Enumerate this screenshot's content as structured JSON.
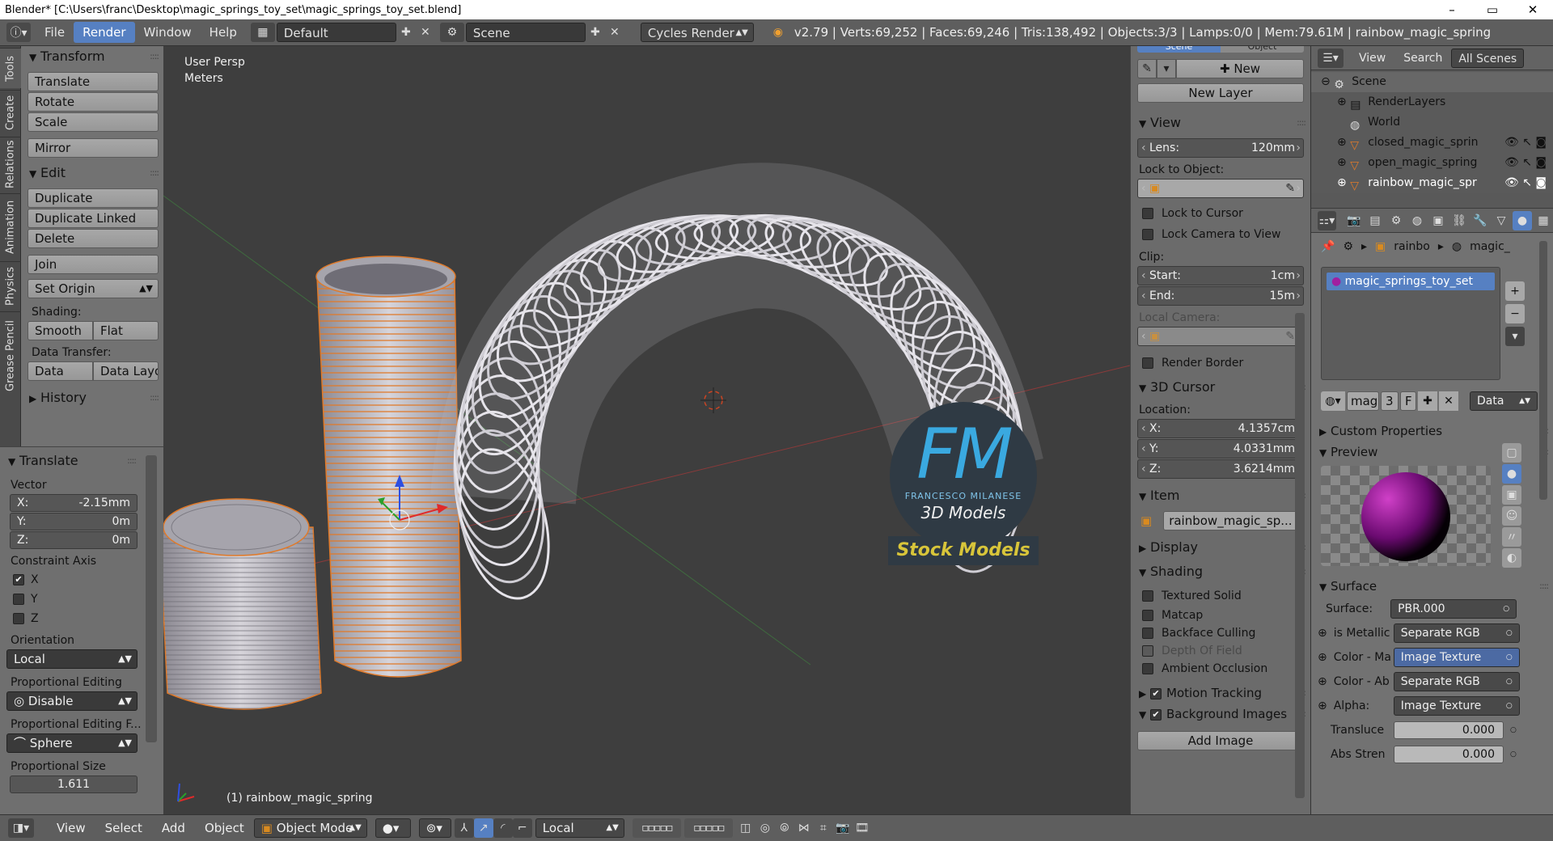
{
  "window": {
    "title": "Blender* [C:\\Users\\franc\\Desktop\\magic_springs_toy_set\\magic_springs_toy_set.blend]",
    "minimize": "–",
    "maximize": "▭",
    "close": "✕"
  },
  "menu": {
    "file": "File",
    "render": "Render",
    "window": "Window",
    "help": "Help",
    "layout": "Default",
    "scene": "Scene",
    "engine": "Cycles Render",
    "stats": "v2.79 | Verts:69,252 | Faces:69,246 | Tris:138,492 | Objects:3/3 | Lamps:0/0 | Mem:79.61M | rainbow_magic_spring"
  },
  "tool_tabs": [
    "Tools",
    "Create",
    "Relations",
    "Animation",
    "Physics",
    "Grease Pencil"
  ],
  "toolshelf": {
    "transform_header": "Transform",
    "translate": "Translate",
    "rotate": "Rotate",
    "scale": "Scale",
    "mirror": "Mirror",
    "edit_header": "Edit",
    "duplicate": "Duplicate",
    "duplicate_linked": "Duplicate Linked",
    "delete": "Delete",
    "join": "Join",
    "set_origin": "Set Origin",
    "shading_label": "Shading:",
    "smooth": "Smooth",
    "flat": "Flat",
    "data_transfer_label": "Data Transfer:",
    "data": "Data",
    "data_layout": "Data Layo",
    "history_header": "History"
  },
  "operator": {
    "header": "Translate",
    "vector_label": "Vector",
    "x_label": "X:",
    "x_value": "-2.15mm",
    "y_label": "Y:",
    "y_value": "0m",
    "z_label": "Z:",
    "z_value": "0m",
    "constraint_label": "Constraint Axis",
    "axis_x": "X",
    "axis_y": "Y",
    "axis_z": "Z",
    "orientation_label": "Orientation",
    "orientation_value": "Local",
    "prop_edit_label": "Proportional Editing",
    "prop_edit_value": "Disable",
    "prop_falloff_label": "Proportional Editing F...",
    "prop_falloff_value": "Sphere",
    "prop_size_label": "Proportional Size",
    "prop_size_value": "1.611"
  },
  "viewport": {
    "view_name": "User Persp",
    "units": "Meters",
    "object_label": "(1) rainbow_magic_spring",
    "logo_letters": "FM",
    "logo_name": "FRANCESCO MILANESE",
    "logo_sub": "3D Models",
    "stock_label": "Stock Models"
  },
  "npanel": {
    "tab_scene": "Scene",
    "tab_object": "Object",
    "new": "New",
    "new_layer": "New Layer",
    "view_header": "View",
    "lens_label": "Lens:",
    "lens_value": "120mm",
    "lock_object_label": "Lock to Object:",
    "lock_cursor": "Lock to Cursor",
    "lock_camera": "Lock Camera to View",
    "clip_label": "Clip:",
    "clip_start_label": "Start:",
    "clip_start_value": "1cm",
    "clip_end_label": "End:",
    "clip_end_value": "15m",
    "local_camera_label": "Local Camera:",
    "render_border": "Render Border",
    "cursor_header": "3D Cursor",
    "location_label": "Location:",
    "cx_label": "X:",
    "cx_value": "4.1357cm",
    "cy_label": "Y:",
    "cy_value": "4.0331mm",
    "cz_label": "Z:",
    "cz_value": "3.6214mm",
    "item_header": "Item",
    "item_name": "rainbow_magic_sp...",
    "display_header": "Display",
    "shading_header": "Shading",
    "textured_solid": "Textured Solid",
    "matcap": "Matcap",
    "backface_culling": "Backface Culling",
    "depth_of_field": "Depth Of Field",
    "ambient_occlusion": "Ambient Occlusion",
    "motion_tracking": "Motion Tracking",
    "background_images": "Background Images",
    "add_image": "Add Image"
  },
  "outliner": {
    "view": "View",
    "search": "Search",
    "filter": "All Scenes",
    "scene": "Scene",
    "render_layers": "RenderLayers",
    "world": "World",
    "obj1": "closed_magic_sprin",
    "obj2": "open_magic_spring",
    "obj3": "rainbow_magic_spr"
  },
  "properties": {
    "crumb_obj": "rainbo",
    "crumb_mat": "magic_",
    "material_slot": "magic_springs_toy_set",
    "mat_short": "mag",
    "users": "3",
    "fake": "F",
    "link": "Data",
    "custom_props": "Custom Properties",
    "preview": "Preview",
    "surface_header": "Surface",
    "surface_label": "Surface:",
    "surface_value": "PBR.000",
    "metal_label": "is Metallic",
    "metal_value": "Separate RGB",
    "colma_label": "Color - Ma",
    "colma_value": "Image Texture",
    "colab_label": "Color - Ab",
    "colab_value": "Separate RGB",
    "alpha_label": "Alpha:",
    "alpha_value": "Image Texture",
    "transl_label": "Transluce",
    "transl_value": "0.000",
    "abs_label": "Abs Stren",
    "abs_value": "0.000"
  },
  "bottom": {
    "view": "View",
    "select": "Select",
    "add": "Add",
    "object": "Object",
    "mode": "Object Mode",
    "orientation": "Local"
  },
  "colors": {
    "accent": "#5680c2",
    "selection_orange": "#e07a2a",
    "logo_blue": "#3aa9e0",
    "stock_yellow": "#d8c53a"
  }
}
